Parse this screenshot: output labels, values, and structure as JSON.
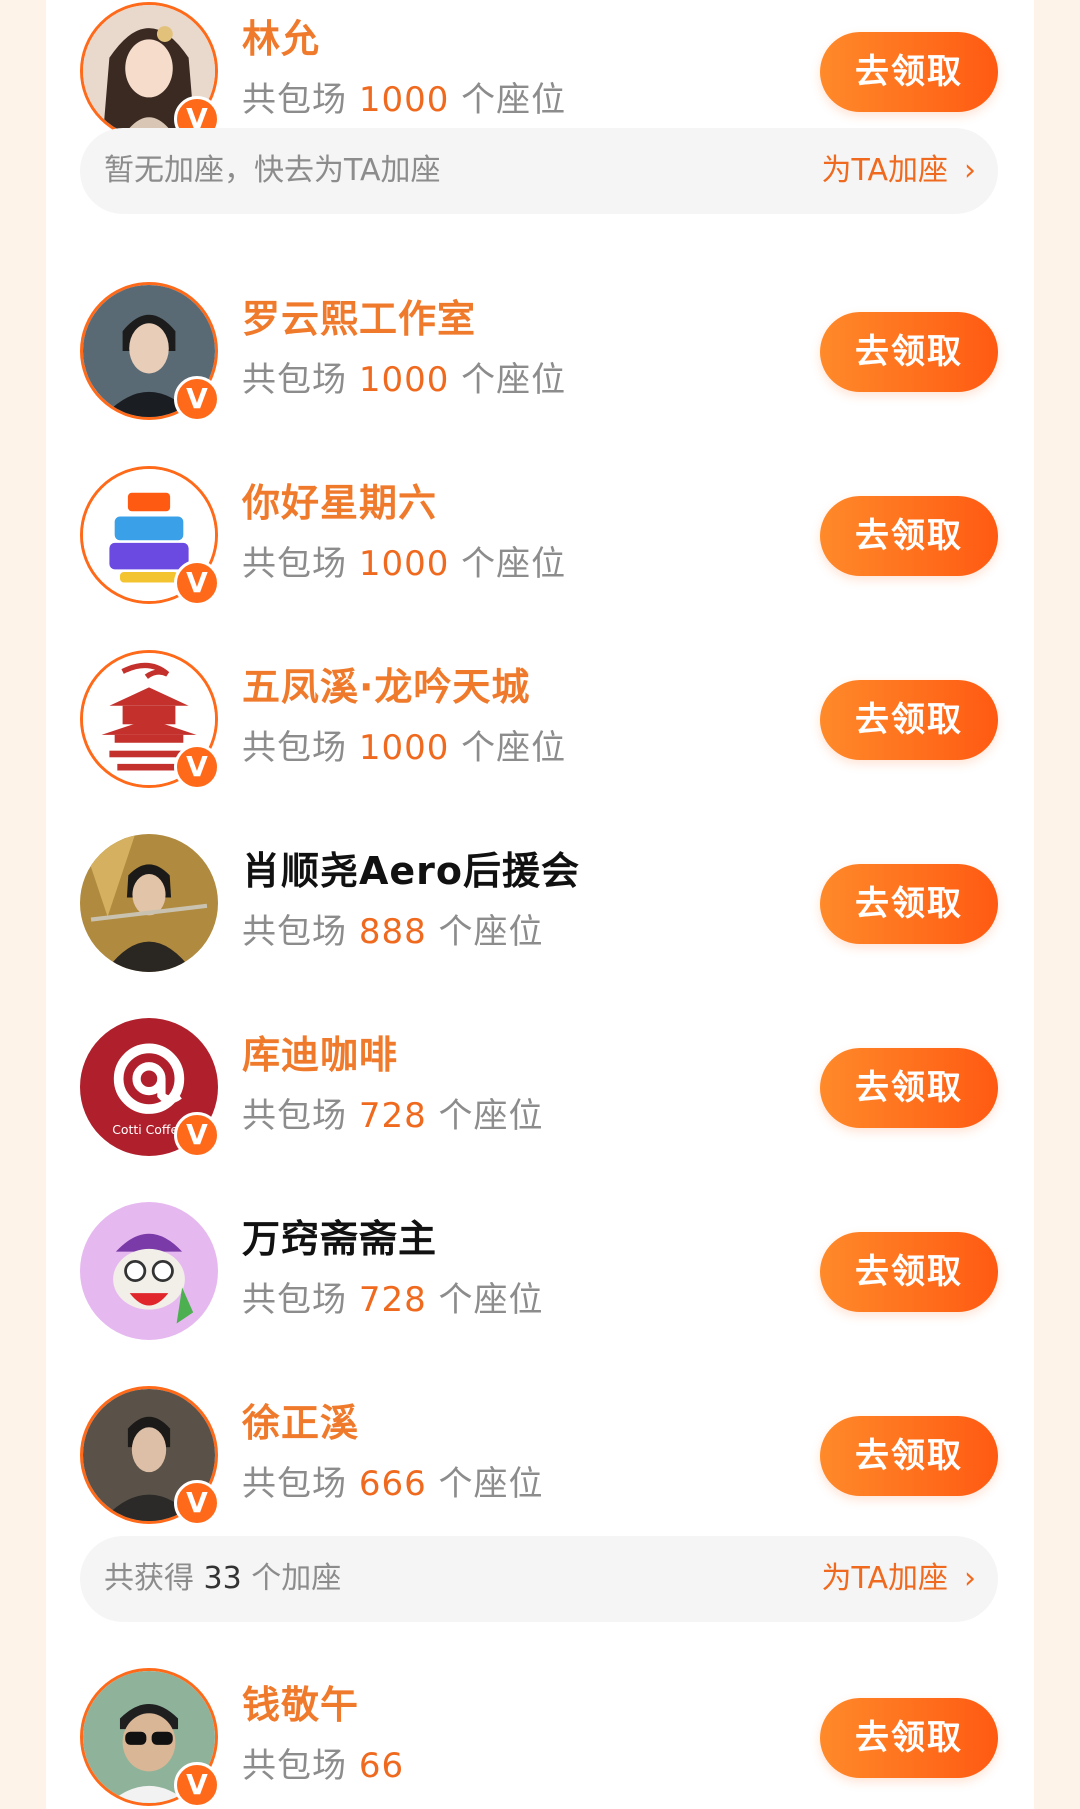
{
  "claim_label": "去领取",
  "verified_badge": "V",
  "colors": {
    "accent": "#ef6a1f",
    "button_start": "#ff8a2a",
    "button_end": "#ff5a12",
    "name_verified": "#f07a2c",
    "muted": "#8c8c8c",
    "bar_bg": "#f5f5f5",
    "page_bg": "#fdf3e8"
  },
  "rows": [
    {
      "name": "林允",
      "verified": true,
      "seats_prefix": "共包场",
      "seats": "1000",
      "seats_suffix": "个座位",
      "avatar_icon": "woman-portrait-icon"
    },
    {
      "name": "罗云熙工作室",
      "verified": true,
      "seats_prefix": "共包场",
      "seats": "1000",
      "seats_suffix": "个座位",
      "avatar_icon": "man-portrait-icon"
    },
    {
      "name": "你好星期六",
      "verified": true,
      "seats_prefix": "共包场",
      "seats": "1000",
      "seats_suffix": "个座位",
      "avatar_icon": "show-logo-icon"
    },
    {
      "name": "五凤溪·龙吟天城",
      "verified": true,
      "seats_prefix": "共包场",
      "seats": "1000",
      "seats_suffix": "个座位",
      "avatar_icon": "pagoda-logo-icon"
    },
    {
      "name": "肖顺尧Aero后援会",
      "verified": false,
      "seats_prefix": "共包场",
      "seats": "888",
      "seats_suffix": "个座位",
      "avatar_icon": "warrior-portrait-icon"
    },
    {
      "name": "库迪咖啡",
      "verified": true,
      "seats_prefix": "共包场",
      "seats": "728",
      "seats_suffix": "个座位",
      "avatar_icon": "cotti-coffee-logo-icon",
      "avatar_text": "Cotti Coffee"
    },
    {
      "name": "万窍斋斋主",
      "verified": false,
      "seats_prefix": "共包场",
      "seats": "728",
      "seats_suffix": "个座位",
      "avatar_icon": "cartoon-mascot-icon"
    },
    {
      "name": "徐正溪",
      "verified": true,
      "seats_prefix": "共包场",
      "seats": "666",
      "seats_suffix": "个座位",
      "avatar_icon": "man-portrait-icon"
    },
    {
      "name": "钱敬午",
      "verified": true,
      "seats_prefix": "共包场",
      "seats": "66",
      "seats_suffix": "",
      "avatar_icon": "man-sunglasses-portrait-icon"
    }
  ],
  "add_bars": [
    {
      "text": "暂无加座，快去为TA加座",
      "link": "为TA加座",
      "chevron": "›"
    },
    {
      "text_prefix": "共获得",
      "count": "33",
      "text_suffix": "个加座",
      "link": "为TA加座",
      "chevron": "›"
    }
  ]
}
